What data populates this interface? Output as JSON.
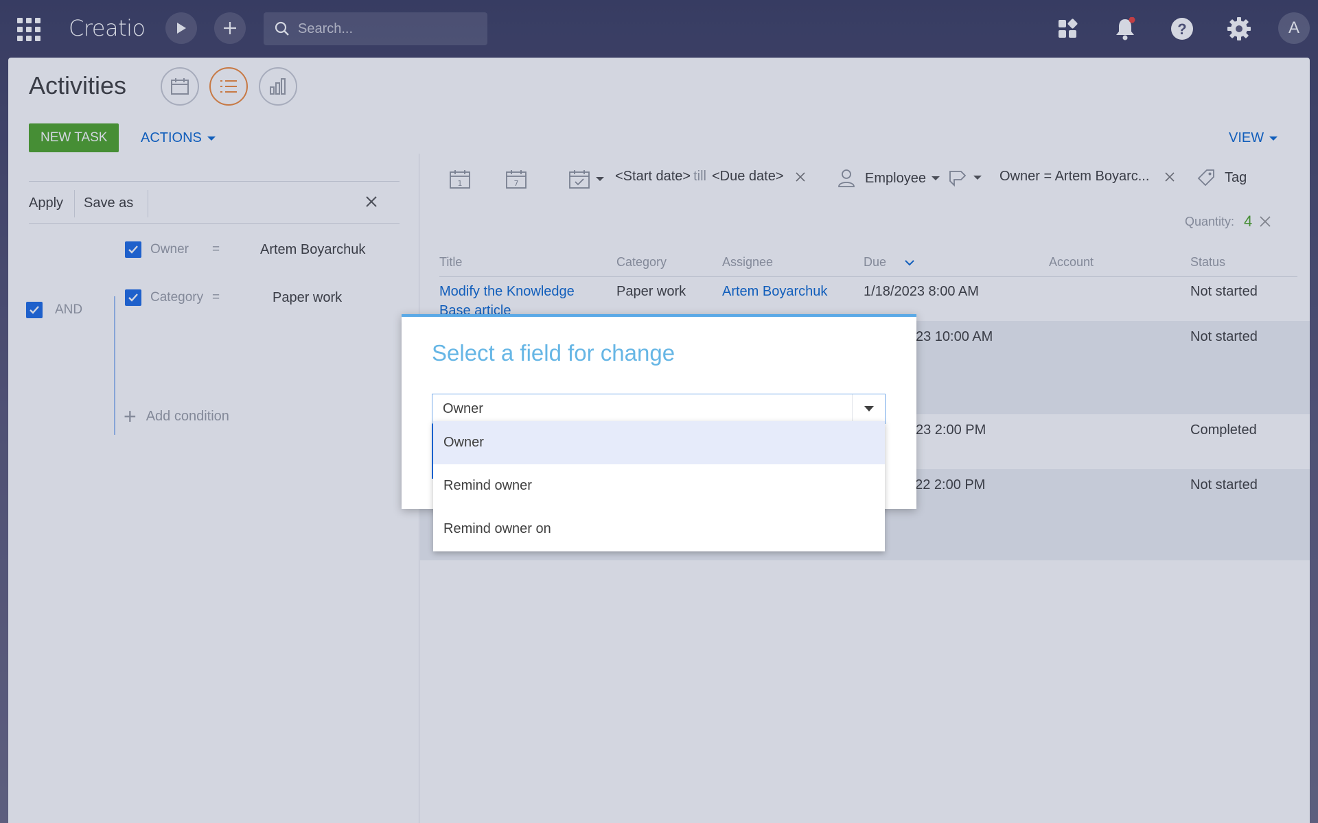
{
  "topbar": {
    "logo": "Creatio",
    "search_placeholder": "Search...",
    "avatar_letter": "A"
  },
  "page": {
    "title": "Activities",
    "new_task_label": "NEW TASK",
    "actions_label": "ACTIONS",
    "view_label": "VIEW"
  },
  "filters": {
    "apply_label": "Apply",
    "save_as_label": "Save as",
    "group_operator": "AND",
    "conditions": [
      {
        "field": "Owner",
        "op": "=",
        "value": "Artem Boyarchuk"
      },
      {
        "field": "Category",
        "op": "=",
        "value": "Paper work"
      }
    ],
    "add_condition_label": "Add condition"
  },
  "quick_filters": {
    "date_start": "<Start date>",
    "date_till": "till",
    "date_due": "<Due date>",
    "employee_label": "Employee",
    "owner_filter": "Owner = Artem Boyarc...",
    "tag_label": "Tag",
    "quantity_label": "Quantity:",
    "quantity_value": "4"
  },
  "grid": {
    "columns": [
      "Title",
      "Category",
      "Assignee",
      "Due",
      "Account",
      "Status"
    ],
    "rows": [
      {
        "title_line1": "Modify the Knowledge",
        "title_line2": "Base article",
        "category": "Paper work",
        "assignee": "Artem Boyarchuk",
        "due": "1/18/2023 8:00 AM",
        "account": "",
        "status": "Not started"
      },
      {
        "due_partial": "23 10:00 AM",
        "status": "Not started"
      },
      {
        "due_partial": "23 2:00 PM",
        "status": "Completed"
      },
      {
        "due_partial": "022 2:00 PM",
        "status": "Not started"
      }
    ]
  },
  "modal": {
    "title": "Select a field for change",
    "input_value": "Owner",
    "options": [
      "Owner",
      "Remind owner",
      "Remind owner on"
    ]
  },
  "colors": {
    "accent_blue": "#0d69d1",
    "new_task_green": "#4fa52a",
    "active_view_orange": "#f08b3d",
    "modal_title": "#66b6e5"
  }
}
